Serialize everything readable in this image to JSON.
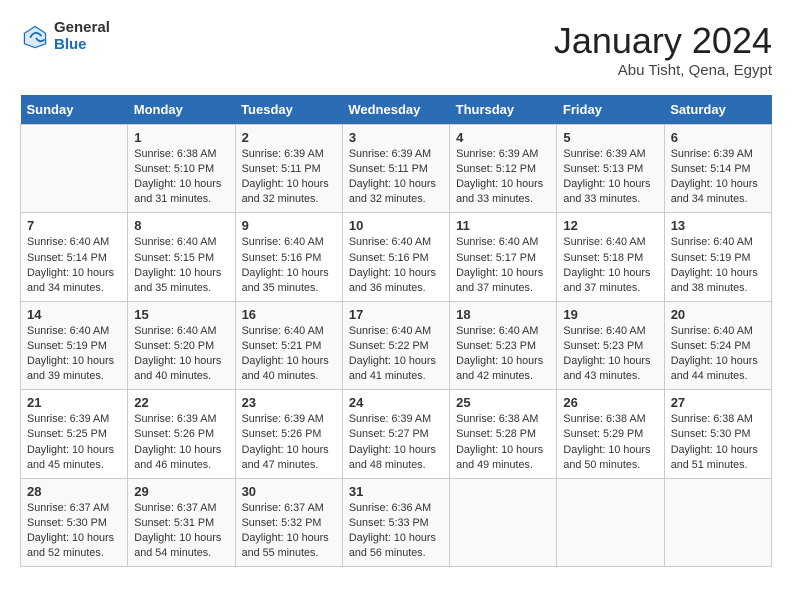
{
  "header": {
    "logo_general": "General",
    "logo_blue": "Blue",
    "month_title": "January 2024",
    "subtitle": "Abu Tisht, Qena, Egypt"
  },
  "days_of_week": [
    "Sunday",
    "Monday",
    "Tuesday",
    "Wednesday",
    "Thursday",
    "Friday",
    "Saturday"
  ],
  "weeks": [
    [
      {
        "day": "",
        "sunrise": "",
        "sunset": "",
        "daylight": ""
      },
      {
        "day": "1",
        "sunrise": "Sunrise: 6:38 AM",
        "sunset": "Sunset: 5:10 PM",
        "daylight": "Daylight: 10 hours and 31 minutes."
      },
      {
        "day": "2",
        "sunrise": "Sunrise: 6:39 AM",
        "sunset": "Sunset: 5:11 PM",
        "daylight": "Daylight: 10 hours and 32 minutes."
      },
      {
        "day": "3",
        "sunrise": "Sunrise: 6:39 AM",
        "sunset": "Sunset: 5:11 PM",
        "daylight": "Daylight: 10 hours and 32 minutes."
      },
      {
        "day": "4",
        "sunrise": "Sunrise: 6:39 AM",
        "sunset": "Sunset: 5:12 PM",
        "daylight": "Daylight: 10 hours and 33 minutes."
      },
      {
        "day": "5",
        "sunrise": "Sunrise: 6:39 AM",
        "sunset": "Sunset: 5:13 PM",
        "daylight": "Daylight: 10 hours and 33 minutes."
      },
      {
        "day": "6",
        "sunrise": "Sunrise: 6:39 AM",
        "sunset": "Sunset: 5:14 PM",
        "daylight": "Daylight: 10 hours and 34 minutes."
      }
    ],
    [
      {
        "day": "7",
        "sunrise": "Sunrise: 6:40 AM",
        "sunset": "Sunset: 5:14 PM",
        "daylight": "Daylight: 10 hours and 34 minutes."
      },
      {
        "day": "8",
        "sunrise": "Sunrise: 6:40 AM",
        "sunset": "Sunset: 5:15 PM",
        "daylight": "Daylight: 10 hours and 35 minutes."
      },
      {
        "day": "9",
        "sunrise": "Sunrise: 6:40 AM",
        "sunset": "Sunset: 5:16 PM",
        "daylight": "Daylight: 10 hours and 35 minutes."
      },
      {
        "day": "10",
        "sunrise": "Sunrise: 6:40 AM",
        "sunset": "Sunset: 5:16 PM",
        "daylight": "Daylight: 10 hours and 36 minutes."
      },
      {
        "day": "11",
        "sunrise": "Sunrise: 6:40 AM",
        "sunset": "Sunset: 5:17 PM",
        "daylight": "Daylight: 10 hours and 37 minutes."
      },
      {
        "day": "12",
        "sunrise": "Sunrise: 6:40 AM",
        "sunset": "Sunset: 5:18 PM",
        "daylight": "Daylight: 10 hours and 37 minutes."
      },
      {
        "day": "13",
        "sunrise": "Sunrise: 6:40 AM",
        "sunset": "Sunset: 5:19 PM",
        "daylight": "Daylight: 10 hours and 38 minutes."
      }
    ],
    [
      {
        "day": "14",
        "sunrise": "Sunrise: 6:40 AM",
        "sunset": "Sunset: 5:19 PM",
        "daylight": "Daylight: 10 hours and 39 minutes."
      },
      {
        "day": "15",
        "sunrise": "Sunrise: 6:40 AM",
        "sunset": "Sunset: 5:20 PM",
        "daylight": "Daylight: 10 hours and 40 minutes."
      },
      {
        "day": "16",
        "sunrise": "Sunrise: 6:40 AM",
        "sunset": "Sunset: 5:21 PM",
        "daylight": "Daylight: 10 hours and 40 minutes."
      },
      {
        "day": "17",
        "sunrise": "Sunrise: 6:40 AM",
        "sunset": "Sunset: 5:22 PM",
        "daylight": "Daylight: 10 hours and 41 minutes."
      },
      {
        "day": "18",
        "sunrise": "Sunrise: 6:40 AM",
        "sunset": "Sunset: 5:23 PM",
        "daylight": "Daylight: 10 hours and 42 minutes."
      },
      {
        "day": "19",
        "sunrise": "Sunrise: 6:40 AM",
        "sunset": "Sunset: 5:23 PM",
        "daylight": "Daylight: 10 hours and 43 minutes."
      },
      {
        "day": "20",
        "sunrise": "Sunrise: 6:40 AM",
        "sunset": "Sunset: 5:24 PM",
        "daylight": "Daylight: 10 hours and 44 minutes."
      }
    ],
    [
      {
        "day": "21",
        "sunrise": "Sunrise: 6:39 AM",
        "sunset": "Sunset: 5:25 PM",
        "daylight": "Daylight: 10 hours and 45 minutes."
      },
      {
        "day": "22",
        "sunrise": "Sunrise: 6:39 AM",
        "sunset": "Sunset: 5:26 PM",
        "daylight": "Daylight: 10 hours and 46 minutes."
      },
      {
        "day": "23",
        "sunrise": "Sunrise: 6:39 AM",
        "sunset": "Sunset: 5:26 PM",
        "daylight": "Daylight: 10 hours and 47 minutes."
      },
      {
        "day": "24",
        "sunrise": "Sunrise: 6:39 AM",
        "sunset": "Sunset: 5:27 PM",
        "daylight": "Daylight: 10 hours and 48 minutes."
      },
      {
        "day": "25",
        "sunrise": "Sunrise: 6:38 AM",
        "sunset": "Sunset: 5:28 PM",
        "daylight": "Daylight: 10 hours and 49 minutes."
      },
      {
        "day": "26",
        "sunrise": "Sunrise: 6:38 AM",
        "sunset": "Sunset: 5:29 PM",
        "daylight": "Daylight: 10 hours and 50 minutes."
      },
      {
        "day": "27",
        "sunrise": "Sunrise: 6:38 AM",
        "sunset": "Sunset: 5:30 PM",
        "daylight": "Daylight: 10 hours and 51 minutes."
      }
    ],
    [
      {
        "day": "28",
        "sunrise": "Sunrise: 6:37 AM",
        "sunset": "Sunset: 5:30 PM",
        "daylight": "Daylight: 10 hours and 52 minutes."
      },
      {
        "day": "29",
        "sunrise": "Sunrise: 6:37 AM",
        "sunset": "Sunset: 5:31 PM",
        "daylight": "Daylight: 10 hours and 54 minutes."
      },
      {
        "day": "30",
        "sunrise": "Sunrise: 6:37 AM",
        "sunset": "Sunset: 5:32 PM",
        "daylight": "Daylight: 10 hours and 55 minutes."
      },
      {
        "day": "31",
        "sunrise": "Sunrise: 6:36 AM",
        "sunset": "Sunset: 5:33 PM",
        "daylight": "Daylight: 10 hours and 56 minutes."
      },
      {
        "day": "",
        "sunrise": "",
        "sunset": "",
        "daylight": ""
      },
      {
        "day": "",
        "sunrise": "",
        "sunset": "",
        "daylight": ""
      },
      {
        "day": "",
        "sunrise": "",
        "sunset": "",
        "daylight": ""
      }
    ]
  ]
}
